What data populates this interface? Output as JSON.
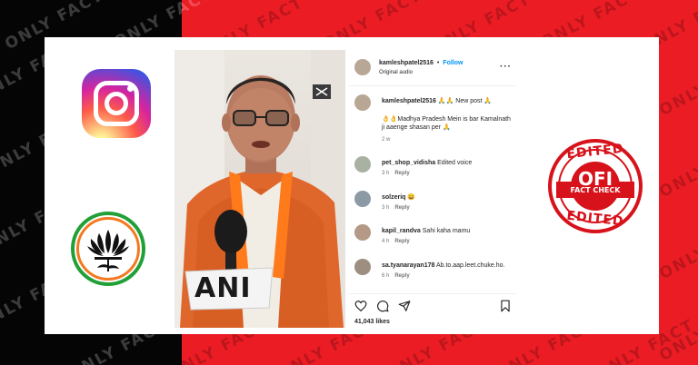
{
  "watermark": {
    "text": "ONLY FACT"
  },
  "colors": {
    "red_bg": "#ec1c24",
    "dark_bg": "#050505",
    "instagram_blue": "#0095f6",
    "bjp_green": "#21a038",
    "bjp_saffron": "#f47920"
  },
  "video": {
    "badge_text": "ANI"
  },
  "post": {
    "username": "kamleshpatel2516",
    "separator": "•",
    "follow_label": "Follow",
    "audio": "Original audio",
    "caption_user": "kamleshpatel2516",
    "caption_emoji": "🙏🙏",
    "caption_title": "New post 🙏",
    "caption_body": "👌👌Madhya Pradesh Mein is bar Kamalnath ji aaenge shasan per 🙏",
    "caption_time": "2 w",
    "more_icon": "more-options-icon"
  },
  "comments": [
    {
      "user": "pet_shop_vidisha",
      "text": "Edited voice",
      "time": "3 h",
      "reply": "Reply"
    },
    {
      "user": "solzeriq",
      "text": "😀",
      "time": "3 h",
      "reply": "Reply"
    },
    {
      "user": "kapil_randva",
      "text": "Sahi kaha mamu",
      "time": "4 h",
      "reply": "Reply"
    },
    {
      "user": "sa.tyanarayan178",
      "text": "Ab.to.aap.leet.chuke.ho.",
      "time": "6 h",
      "reply": "Reply"
    }
  ],
  "actions": {
    "likes": "41,043 likes"
  },
  "stamp": {
    "top": "EDITED",
    "center": "OFI",
    "sub": "FACT CHECK",
    "bottom": "EDITED"
  }
}
